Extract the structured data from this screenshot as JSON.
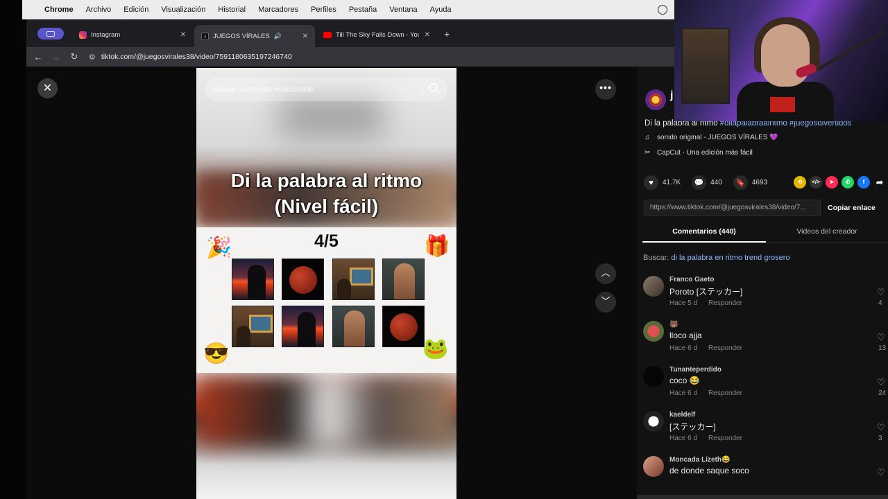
{
  "menubar": {
    "items": [
      "Chrome",
      "Archivo",
      "Edición",
      "Visualización",
      "Historial",
      "Marcadores",
      "Perfiles",
      "Pestaña",
      "Ventana",
      "Ayuda"
    ]
  },
  "tabs": [
    {
      "label": "Instagram"
    },
    {
      "label": "JUEGOS VÍRALES"
    },
    {
      "label": "Till The Sky Falls Down - You"
    }
  ],
  "address": {
    "url": "tiktok.com/@juegosvirales38/video/7591180635197246740"
  },
  "video": {
    "search_placeholder": "Buscar contenido relacionado",
    "title_line1": "Di la palabra al ritmo",
    "title_line2": "(Nivel fácil)",
    "counter": "4/5",
    "tiles": [
      "sunset-reaper",
      "red-moon",
      "museum-painting",
      "bodybuilder",
      "museum-painting",
      "sunset-reaper",
      "bodybuilder",
      "red-moon"
    ]
  },
  "creator": {
    "name": "j",
    "description": "Di la palabra al ritmo",
    "hashtags": "#dilapalabraalritmo #juegosdivertidos",
    "sound": "sonido original - JUEGOS VÍRALES 💜",
    "capcut": "CapCut · Una edición más fácil"
  },
  "actions": {
    "likes": "41.7K",
    "comments": "440",
    "saves": "4693"
  },
  "link": {
    "url": "https://www.tiktok.com/@juegosvirales38/video/7...",
    "copy_label": "Copiar enlace"
  },
  "panel_tabs": {
    "comments": "Comentarios (440)",
    "creator_videos": "Videos del creador"
  },
  "search_suggestion": {
    "prefix": "Buscar:",
    "query": "di la palabra en ritmo trend grosero"
  },
  "comments": [
    {
      "user": "Franco Gaeto",
      "text": "Poroto [ステッカー]",
      "time": "Hace 5 d",
      "reply": "Responder",
      "likes": "4"
    },
    {
      "user": "🐻",
      "text": "lloco ajja",
      "time": "Hace 6 d",
      "reply": "Responder",
      "likes": "13"
    },
    {
      "user": "Tunanteperdido",
      "text": "coco 😂",
      "time": "Hace 6 d",
      "reply": "Responder",
      "likes": "24"
    },
    {
      "user": "kaeldelf",
      "text": "[ステッカー]",
      "time": "Hace 6 d",
      "reply": "Responder",
      "likes": "3"
    },
    {
      "user": "Moncada Lizeth😂",
      "text": "de donde saque soco",
      "time": "",
      "reply": "",
      "likes": ""
    }
  ],
  "colors": {
    "accent_tab": "#5a55c9",
    "hashtag": "#8fb8ff",
    "panel_bg": "#121212"
  }
}
